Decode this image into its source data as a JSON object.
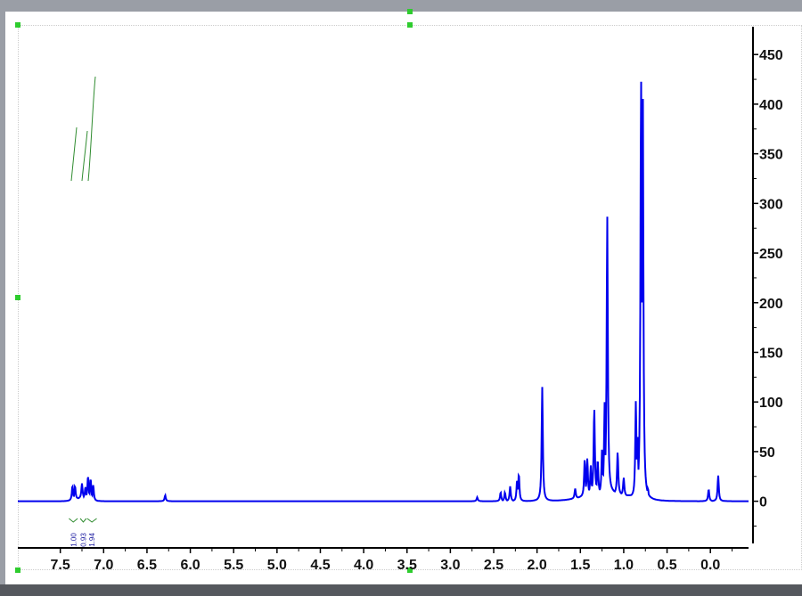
{
  "chart_data": {
    "type": "line",
    "title": "1H NMR spectrum",
    "xlabel": "",
    "ylabel": "",
    "xlim": [
      7.99,
      -0.44
    ],
    "ylim": [
      -47,
      478
    ],
    "x_ticks": [
      "7.5",
      "7.0",
      "6.5",
      "6.0",
      "5.5",
      "5.0",
      "4.5",
      "4.0",
      "3.5",
      "3.0",
      "2.5",
      "2.0",
      "1.5",
      "1.0",
      "0.5",
      "0.0"
    ],
    "y_ticks": [
      "0",
      "50",
      "100",
      "150",
      "200",
      "250",
      "300",
      "350",
      "400",
      "450"
    ],
    "grid": false,
    "series_color": "#0000ee",
    "integral_color": "#2e8b2e",
    "peaks_ppm_height": [
      [
        7.36,
        15
      ],
      [
        7.33,
        14
      ],
      [
        7.25,
        15
      ],
      [
        7.21,
        12
      ],
      [
        7.18,
        24
      ],
      [
        7.15,
        22
      ],
      [
        7.12,
        16
      ],
      [
        6.29,
        6
      ],
      [
        2.69,
        4
      ],
      [
        2.42,
        9
      ],
      [
        2.37,
        9
      ],
      [
        2.31,
        15
      ],
      [
        2.23,
        22
      ],
      [
        2.21,
        28
      ],
      [
        1.94,
        115
      ],
      [
        1.56,
        10
      ],
      [
        1.45,
        38
      ],
      [
        1.42,
        38
      ],
      [
        1.38,
        30
      ],
      [
        1.34,
        88
      ],
      [
        1.3,
        35
      ],
      [
        1.25,
        45
      ],
      [
        1.22,
        92
      ],
      [
        1.19,
        280
      ],
      [
        1.07,
        43
      ],
      [
        1.0,
        18
      ],
      [
        0.86,
        98
      ],
      [
        0.84,
        62
      ],
      [
        0.8,
        430
      ],
      [
        0.78,
        423
      ],
      [
        0.72,
        12
      ],
      [
        0.02,
        12
      ],
      [
        -0.09,
        26
      ]
    ],
    "integrals": [
      {
        "range": [
          7.4,
          7.3
        ],
        "value": "1.00"
      },
      {
        "range": [
          7.27,
          7.2
        ],
        "value": "0.93"
      },
      {
        "range": [
          7.19,
          7.08
        ],
        "value": "1.94"
      }
    ]
  }
}
